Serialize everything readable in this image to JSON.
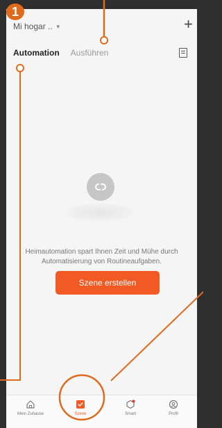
{
  "header": {
    "home_name": "Mi hogar ..",
    "add_label": "+"
  },
  "tabs": [
    {
      "label": "Automation",
      "active": true
    },
    {
      "label": "Ausführen",
      "active": false
    }
  ],
  "empty_state": {
    "description": "Heimautomation spart Ihnen Zeit und Mühe durch Automatisierung von Routineaufgaben.",
    "cta_label": "Szene erstellen"
  },
  "bottom_nav": [
    {
      "label": "Mein Zuhause",
      "icon": "home-icon",
      "active": false
    },
    {
      "label": "Szene",
      "icon": "scene-icon",
      "active": true
    },
    {
      "label": "Smart",
      "icon": "smart-icon",
      "active": false
    },
    {
      "label": "Profil",
      "icon": "profile-icon",
      "active": false
    }
  ],
  "annotation": {
    "step_number": "1"
  },
  "colors": {
    "accent": "#f15a24",
    "annotation": "#e06a1b",
    "frame": "#2e2e2e"
  }
}
